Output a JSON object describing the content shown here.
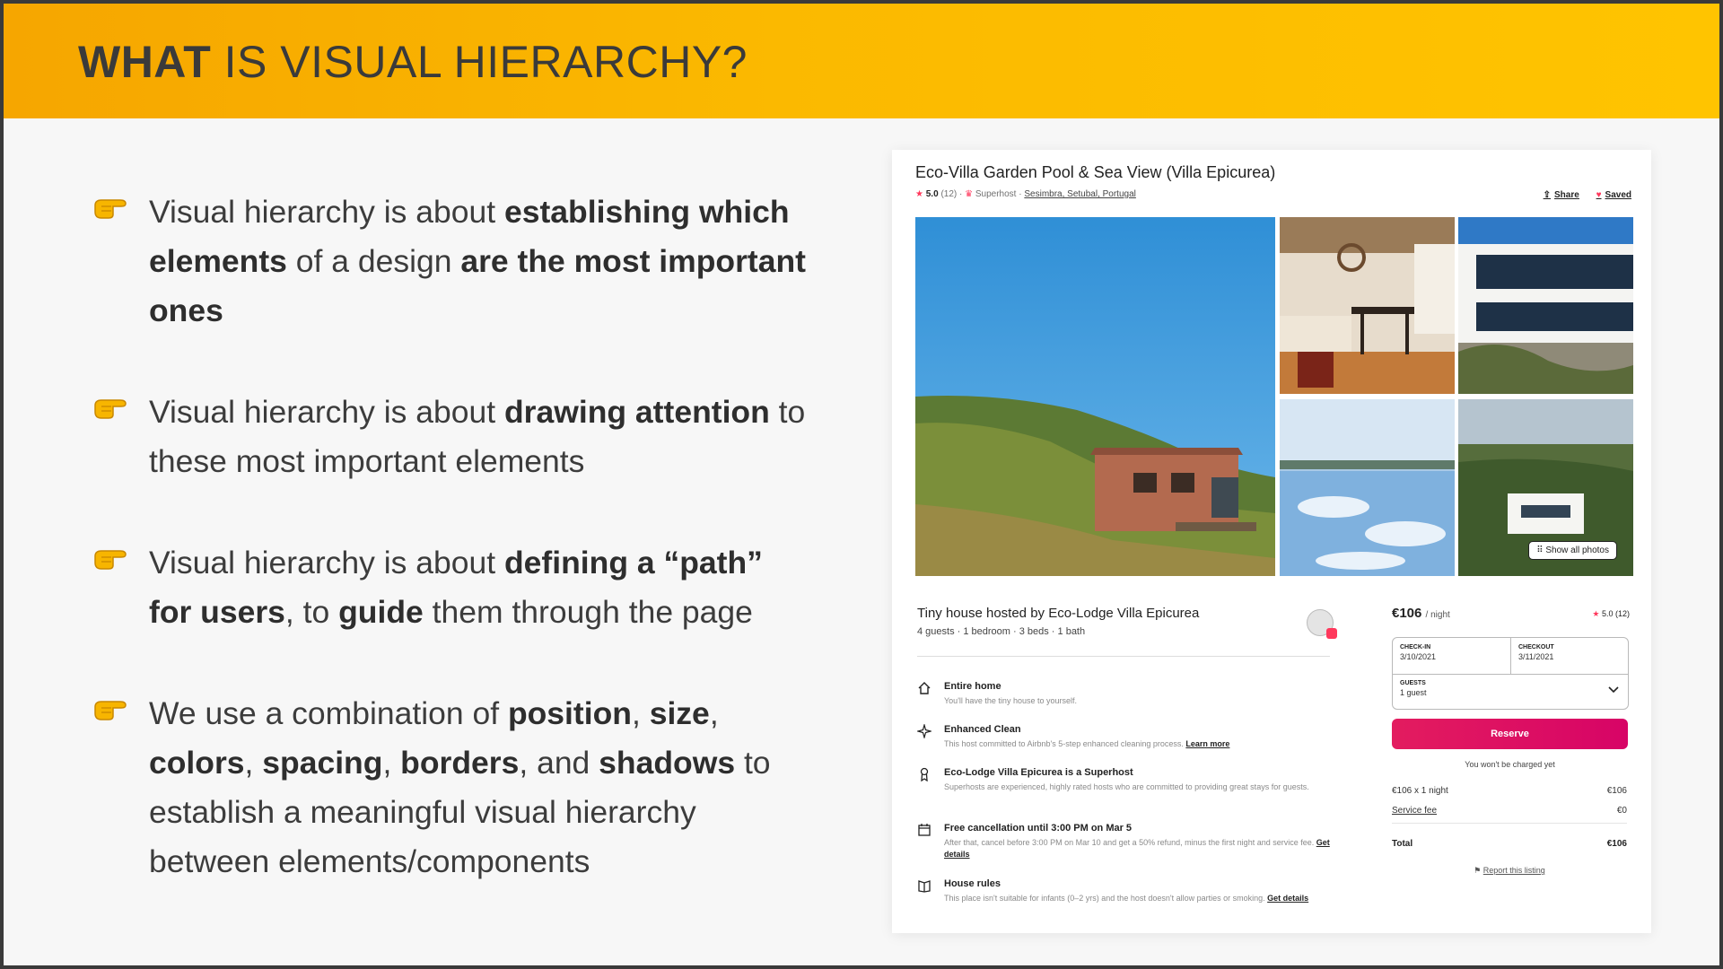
{
  "slide": {
    "title_bold": "WHAT",
    "title_rest": "IS VISUAL HIERARCHY?",
    "bullets": [
      {
        "parts": [
          {
            "t": "Visual hierarchy is about ",
            "b": false
          },
          {
            "t": "establishing which elements",
            "b": true
          },
          {
            "t": " of a design ",
            "b": false
          },
          {
            "t": "are the most important ones",
            "b": true
          }
        ]
      },
      {
        "parts": [
          {
            "t": "Visual hierarchy is about ",
            "b": false
          },
          {
            "t": "drawing attention",
            "b": true
          },
          {
            "t": " to these most important elements",
            "b": false
          }
        ]
      },
      {
        "parts": [
          {
            "t": "Visual hierarchy is about ",
            "b": false
          },
          {
            "t": "defining a “path” for users",
            "b": true
          },
          {
            "t": ", to ",
            "b": false
          },
          {
            "t": "guide",
            "b": true
          },
          {
            "t": " them through the page",
            "b": false
          }
        ]
      },
      {
        "parts": [
          {
            "t": "We use a combination of ",
            "b": false
          },
          {
            "t": "position",
            "b": true
          },
          {
            "t": ", ",
            "b": false
          },
          {
            "t": "size",
            "b": true
          },
          {
            "t": ", ",
            "b": false
          },
          {
            "t": "colors",
            "b": true
          },
          {
            "t": ", ",
            "b": false
          },
          {
            "t": "spacing",
            "b": true
          },
          {
            "t": ", ",
            "b": false
          },
          {
            "t": "borders",
            "b": true
          },
          {
            "t": ", and ",
            "b": false
          },
          {
            "t": "shadows",
            "b": true
          },
          {
            "t": " to establish a meaningful visual hierarchy between elements/components",
            "b": false
          }
        ]
      }
    ],
    "bullet_icon": "pointing-hand-icon",
    "colors": {
      "header_start": "#f6a600",
      "header_end": "#ffc400",
      "accent": "#ff385c",
      "reserve": "#e31c5f"
    }
  },
  "listing": {
    "title": "Eco-Villa Garden Pool & Sea View (Villa Epicurea)",
    "rating": "5.0",
    "reviews": "(12)",
    "superhost": "Superhost",
    "location": "Sesimbra, Setubal, Portugal",
    "share": "Share",
    "saved": "Saved",
    "show_all_photos": "Show all photos",
    "host_title": "Tiny house hosted by Eco-Lodge Villa Epicurea",
    "host_sub": "4 guests · 1 bedroom · 3 beds · 1 bath",
    "features": [
      {
        "title": "Entire home",
        "desc": "You'll have the tiny house to yourself.",
        "link": ""
      },
      {
        "title": "Enhanced Clean",
        "desc": "This host committed to Airbnb's 5-step enhanced cleaning process.",
        "link": "Learn more"
      },
      {
        "title": "Eco-Lodge Villa Epicurea is a Superhost",
        "desc": "Superhosts are experienced, highly rated hosts who are committed to providing great stays for guests.",
        "link": ""
      },
      {
        "title": "Free cancellation until 3:00 PM on Mar 5",
        "desc": "After that, cancel before 3:00 PM on Mar 10 and get a 50% refund, minus the first night and service fee.",
        "link": "Get details"
      },
      {
        "title": "House rules",
        "desc": "This place isn't suitable for infants (0–2 yrs) and the host doesn't allow parties or smoking.",
        "link": "Get details"
      }
    ],
    "booking": {
      "price": "€106",
      "per_night": "/ night",
      "rating": "5.0",
      "reviews": "(12)",
      "checkin_label": "CHECK-IN",
      "checkin_value": "3/10/2021",
      "checkout_label": "CHECKOUT",
      "checkout_value": "3/11/2021",
      "guests_label": "GUESTS",
      "guests_value": "1 guest",
      "reserve": "Reserve",
      "not_charged": "You won't be charged yet",
      "line1_label": "€106 x 1 night",
      "line1_value": "€106",
      "line2_label": "Service fee",
      "line2_value": "€0",
      "total_label": "Total",
      "total_value": "€106",
      "report": "Report this listing"
    }
  }
}
